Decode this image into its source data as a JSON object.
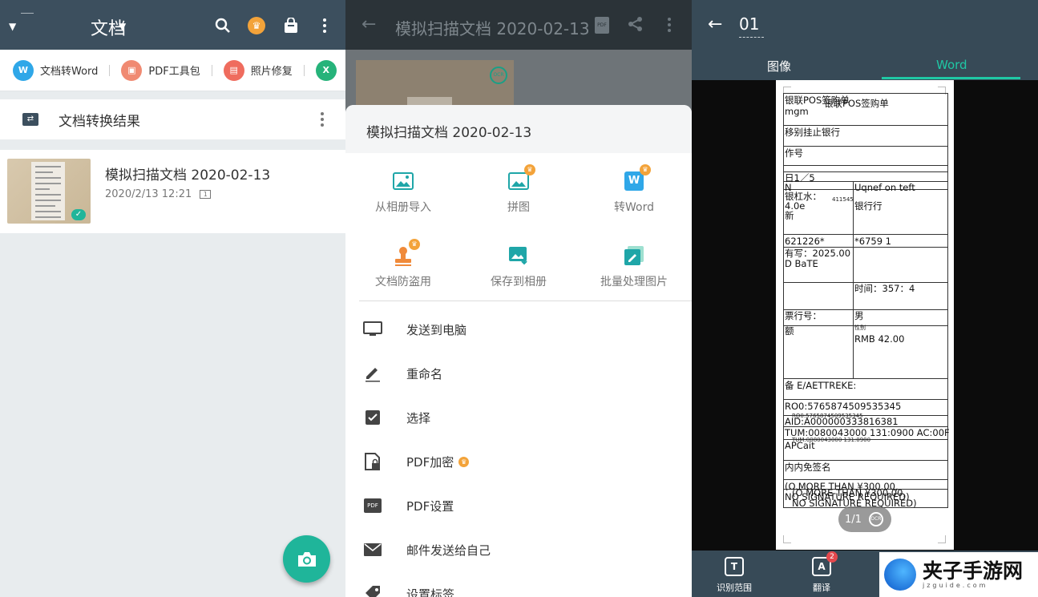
{
  "panel1": {
    "header": {
      "title": "文档"
    },
    "tools": [
      {
        "label": "文档转Word",
        "icon": "word-icon",
        "color": "#2fa7e8",
        "glyph": "W"
      },
      {
        "label": "PDF工具包",
        "icon": "toolbox-icon",
        "color": "#f08a72",
        "glyph": "▣"
      },
      {
        "label": "照片修复",
        "icon": "photo-repair-icon",
        "color": "#ef6c5e",
        "glyph": "▤"
      },
      {
        "label": "",
        "icon": "excel-icon",
        "color": "#26b37a",
        "glyph": "X"
      }
    ],
    "section": {
      "label": "文档转换结果"
    },
    "document": {
      "title": "模拟扫描文档 2020-02-13",
      "datetime": "2020/2/13 12:21",
      "pages": "1"
    }
  },
  "panel2": {
    "header": {
      "title": "模拟扫描文档 2020-02-13"
    },
    "sheet": {
      "title": "模拟扫描文档 2020-02-13",
      "grid": [
        {
          "label": "从相册导入",
          "icon": "image-import-icon",
          "premium": false
        },
        {
          "label": "拼图",
          "icon": "collage-icon",
          "premium": true
        },
        {
          "label": "转Word",
          "icon": "word-convert-icon",
          "premium": true
        },
        {
          "label": "文档防盗用",
          "icon": "stamp-icon",
          "premium": true
        },
        {
          "label": "保存到相册",
          "icon": "save-to-album-icon",
          "premium": false
        },
        {
          "label": "批量处理图片",
          "icon": "batch-edit-icon",
          "premium": false
        }
      ],
      "menu": [
        {
          "label": "发送到电脑",
          "icon": "monitor-icon",
          "premium": false
        },
        {
          "label": "重命名",
          "icon": "pencil-icon",
          "premium": false
        },
        {
          "label": "选择",
          "icon": "checkbox-icon",
          "premium": false
        },
        {
          "label": "PDF加密",
          "icon": "pdf-lock-icon",
          "premium": true
        },
        {
          "label": "PDF设置",
          "icon": "pdf-settings-icon",
          "premium": false
        },
        {
          "label": "邮件发送给自己",
          "icon": "mail-icon",
          "premium": false
        },
        {
          "label": "设置标签",
          "icon": "tag-icon",
          "premium": false
        }
      ]
    }
  },
  "panel3": {
    "header": {
      "title": "01"
    },
    "tabs": [
      {
        "label": "图像"
      },
      {
        "label": "Word"
      }
    ],
    "receipt": {
      "rows": [
        {
          "left": "银联POS签购单",
          "right": ""
        },
        {
          "left": "mgm",
          "right": ""
        },
        {
          "left": "移别挂止银行",
          "right": ""
        },
        {
          "left": "作号",
          "right": ""
        },
        {
          "left": "日1／5",
          "right": ""
        },
        {
          "left": "N",
          "right": "Uqnef on teft"
        },
        {
          "left": "银杠水：",
          "right": "411545"
        },
        {
          "left": "4.0e",
          "right": "银行行"
        },
        {
          "left": "新",
          "right": ""
        },
        {
          "left": "621226*",
          "right": "*6759  1"
        },
        {
          "left": "有写：2025.00",
          "right": ""
        },
        {
          "left": "D BaTE",
          "right": ""
        },
        {
          "left": "",
          "right": "时间：357：4"
        },
        {
          "left": "票行号：",
          "right": "男"
        },
        {
          "left": "额",
          "right": "RMB 42.00"
        },
        {
          "left": "备 E/AETTREKE:",
          "right": ""
        },
        {
          "left": "RO0:5765874509535345",
          "right": ""
        },
        {
          "left": "AID:A000000333816381",
          "right": ""
        },
        {
          "left": "TUM:0080043000 131:0900  AC:00F",
          "right": ""
        },
        {
          "left": "APCait",
          "right": ""
        },
        {
          "left": "内内免签名",
          "right": ""
        },
        {
          "left": "(O.MORE THAN ¥300.00,",
          "right": ""
        },
        {
          "left": "NO SIGNATURE REQUIRED)",
          "right": ""
        }
      ],
      "overlay_title": "银联POS签购单",
      "overlay_ro": "RO0:5765874509535345",
      "overlay_tum": "TUM:0080043000 131:0900",
      "overlay_more": "(O MORE THAN ¥300.00,",
      "overlay_sig": "NO SIGNATURE REQUIRED)",
      "overlay_gender": "性别"
    },
    "pager": {
      "label": "1/1"
    },
    "bottom": [
      {
        "label": "识别范围",
        "icon": "recognize-area-icon",
        "glyph": "T"
      },
      {
        "label": "翻译",
        "icon": "translate-icon",
        "glyph": "A",
        "badge": "2"
      }
    ],
    "watermark": {
      "title": "夹子手游网",
      "subtitle": "jzguide.com"
    }
  },
  "colors": {
    "accent": "#1fb59a",
    "header": "#3c4f5e",
    "premium": "#f3a33a"
  }
}
